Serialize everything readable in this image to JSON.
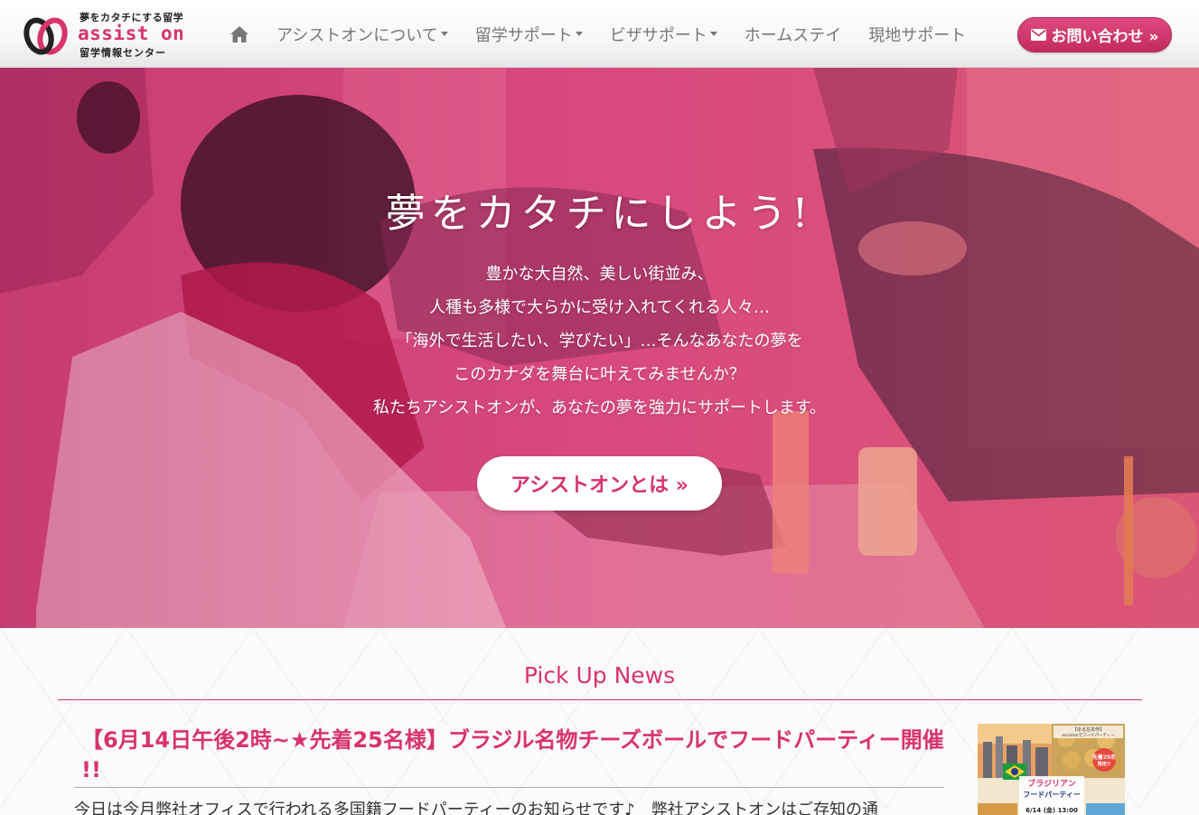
{
  "header": {
    "logo": {
      "tagline": "夢をカタチにする留学",
      "name": "assist on",
      "sub": "留学情報センター"
    },
    "nav": {
      "home_icon": "home-icon",
      "items": [
        {
          "label": "アシストオンについて",
          "has_dropdown": true
        },
        {
          "label": "留学サポート",
          "has_dropdown": true
        },
        {
          "label": "ビザサポート",
          "has_dropdown": true
        },
        {
          "label": "ホームステイ",
          "has_dropdown": false
        },
        {
          "label": "現地サポート",
          "has_dropdown": false
        }
      ],
      "contact_button": {
        "label": "お問い合わせ »",
        "icon": "envelope-icon"
      }
    }
  },
  "hero": {
    "title": "夢をカタチにしよう!",
    "lines": [
      "豊かな大自然、美しい街並み、",
      "人種も多様で大らかに受け入れてくれる人々…",
      "「海外で生活したい、学びたい」…そんなあなたの夢を",
      "このカナダを舞台に叶えてみませんか？",
      "私たちアシストオンが、あなたの夢を強力にサポートします。"
    ],
    "button_label": "アシストオンとは »"
  },
  "news": {
    "heading": "Pick Up News",
    "article": {
      "title": "【6月14日午後2時~★先着25名様】ブラジル名物チーズボールでフードパーティー開催 !!",
      "excerpt": "今日は今月弊社オフィスで行われる多国籍フードパーティーのお知らせです♪　弊社アシストオンはご存知の通",
      "thumbnail": {
        "banner_line1": "ブラジリアン",
        "banner_line2": "フードパーティー",
        "date": "6/14 (金) 13:00",
        "badge": "先着25名",
        "badge_sub": "限定!!",
        "note_title": "【ゆる在本作】",
        "note_body": "assistonでフードパーティー"
      }
    }
  },
  "colors": {
    "brand_pink": "#d8336e",
    "nav_text": "#777777",
    "hero_gradient_start": "#c43a70",
    "hero_gradient_end": "#e78a6a"
  }
}
